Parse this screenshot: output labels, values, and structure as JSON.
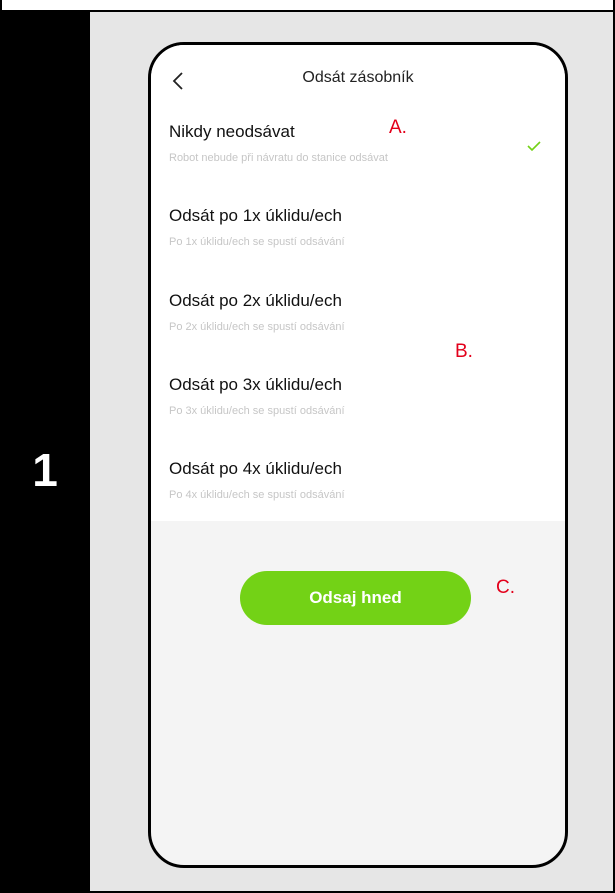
{
  "step": {
    "number": "1"
  },
  "screen": {
    "title": "Odsát zásobník",
    "options": [
      {
        "title": "Nikdy neodsávat",
        "description": "Robot nebude při návratu do stanice odsávat",
        "selected": true
      },
      {
        "title": "Odsát po 1x úklidu/ech",
        "description": "Po 1x úklidu/ech se spustí odsávání",
        "selected": false
      },
      {
        "title": "Odsát po 2x úklidu/ech",
        "description": "Po 2x úklidu/ech se spustí odsávání",
        "selected": false
      },
      {
        "title": "Odsát po 3x úklidu/ech",
        "description": "Po 3x úklidu/ech se spustí odsávání",
        "selected": false
      },
      {
        "title": "Odsát po 4x úklidu/ech",
        "description": "Po 4x úklidu/ech se spustí odsávání",
        "selected": false
      }
    ],
    "primary_button": "Odsaj hned"
  },
  "annotations": {
    "a": "A.",
    "b": "B.",
    "c": "C."
  },
  "colors": {
    "accent_green": "#73d216",
    "annotation_red": "#e3001b",
    "description_gray": "#c6c6c6"
  },
  "icons": {
    "back": "chevron-left-icon",
    "selected": "checkmark-icon"
  }
}
